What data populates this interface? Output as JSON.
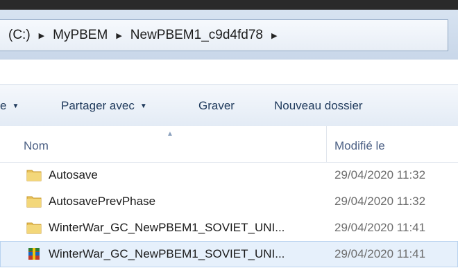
{
  "address": {
    "crumbs": [
      "(C:)",
      "MyPBEM",
      "NewPBEM1_c9d4fd78"
    ]
  },
  "toolbar": {
    "organize_caret": "e",
    "share_label": "Partager avec",
    "burn_label": "Graver",
    "new_folder_label": "Nouveau dossier"
  },
  "columns": {
    "name": "Nom",
    "modified": "Modifié le"
  },
  "files": [
    {
      "name": "Autosave",
      "date": "29/04/2020 11:32",
      "icon": "folder-icon"
    },
    {
      "name": "AutosavePrevPhase",
      "date": "29/04/2020 11:32",
      "icon": "folder-icon"
    },
    {
      "name": "WinterWar_GC_NewPBEM1_SOVIET_UNI...",
      "date": "29/04/2020 11:41",
      "icon": "folder-icon"
    },
    {
      "name": "WinterWar_GC_NewPBEM1_SOVIET_UNI...",
      "date": "29/04/2020 11:41",
      "icon": "archive-icon"
    }
  ],
  "colors": {
    "folder": "#e8c25a",
    "selection": "#e6f0fb"
  }
}
